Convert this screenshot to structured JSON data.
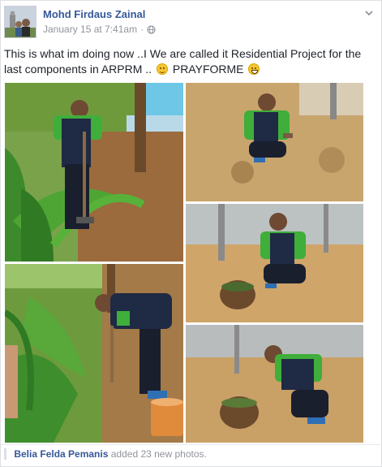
{
  "post": {
    "author": "Mohd Firdaus Zainal",
    "timestamp": "January 15 at 7:41am",
    "separator": "·",
    "audience_icon": "globe-icon",
    "menu_icon": "chevron-down-icon",
    "message_part1": "This is what im doing now ..I We are called it Residential Project for the last components in ARPRM ..",
    "message_part2": "PRAYFORME"
  },
  "photos": [
    {
      "subject": "man in green and navy shirt with shovel planting coconut seedling near the sea"
    },
    {
      "subject": "smiling man crouching on sand giving thumbs up"
    },
    {
      "subject": "man crouching beside basket of plants near fence"
    },
    {
      "subject": "man bending over planting in garden with orange bucket"
    },
    {
      "subject": "man crouching with basket on sand near fence"
    }
  ],
  "footer": {
    "name": "Belia Felda Pemanis",
    "text": "added 23 new photos."
  },
  "colors": {
    "link": "#365899",
    "meta": "#90949c",
    "shirt_green": "#3fae3a",
    "shirt_navy": "#1f2a44"
  }
}
